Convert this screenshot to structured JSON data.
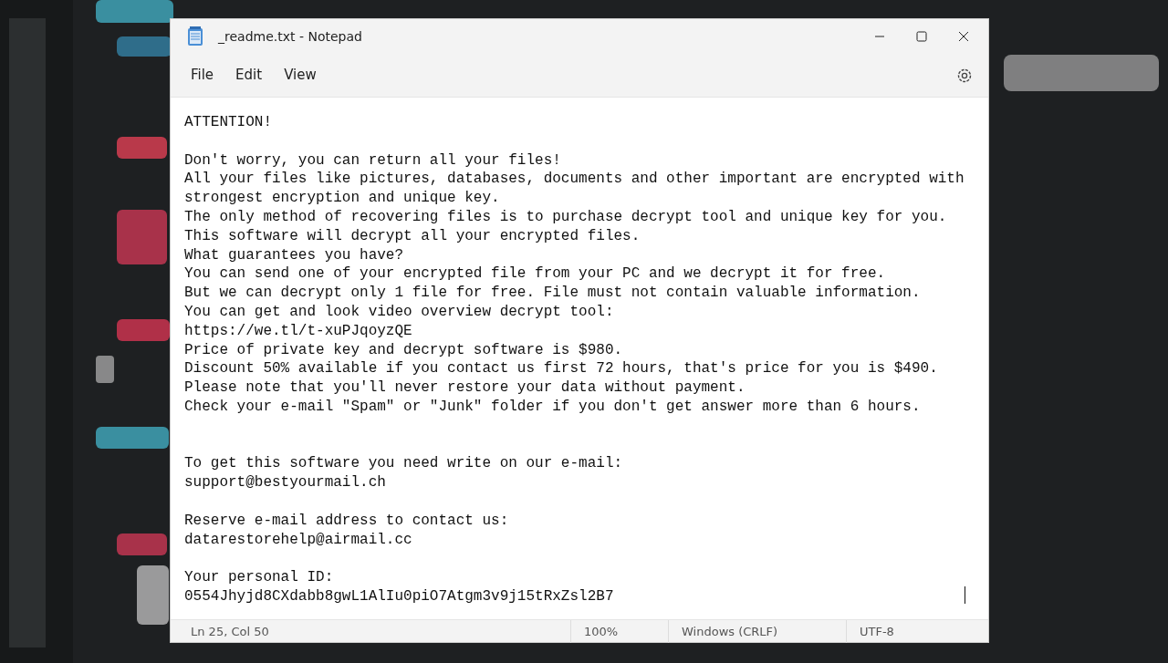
{
  "window": {
    "title": "_readme.txt - Notepad"
  },
  "menu": [
    {
      "label": "File"
    },
    {
      "label": "Edit"
    },
    {
      "label": "View"
    }
  ],
  "document": {
    "text": "ATTENTION!\n\nDon't worry, you can return all your files!\nAll your files like pictures, databases, documents and other important are encrypted with\nstrongest encryption and unique key.\nThe only method of recovering files is to purchase decrypt tool and unique key for you.\nThis software will decrypt all your encrypted files.\nWhat guarantees you have?\nYou can send one of your encrypted file from your PC and we decrypt it for free.\nBut we can decrypt only 1 file for free. File must not contain valuable information.\nYou can get and look video overview decrypt tool:\nhttps://we.tl/t-xuPJqoyzQE\nPrice of private key and decrypt software is $980.\nDiscount 50% available if you contact us first 72 hours, that's price for you is $490.\nPlease note that you'll never restore your data without payment.\nCheck your e-mail \"Spam\" or \"Junk\" folder if you don't get answer more than 6 hours.\n\n\nTo get this software you need write on our e-mail:\nsupport@bestyourmail.ch\n\nReserve e-mail address to contact us:\ndatarestorehelp@airmail.cc\n\nYour personal ID:\n0554Jhyjd8CXdabb8gwL1AlIu0piO7Atgm3v9j15tRxZsl2B7"
  },
  "status_bar": [
    {
      "text": "Ln 25, Col 50"
    },
    {
      "text": "100%"
    },
    {
      "text": "Windows (CRLF)"
    },
    {
      "text": "UTF-8"
    }
  ]
}
